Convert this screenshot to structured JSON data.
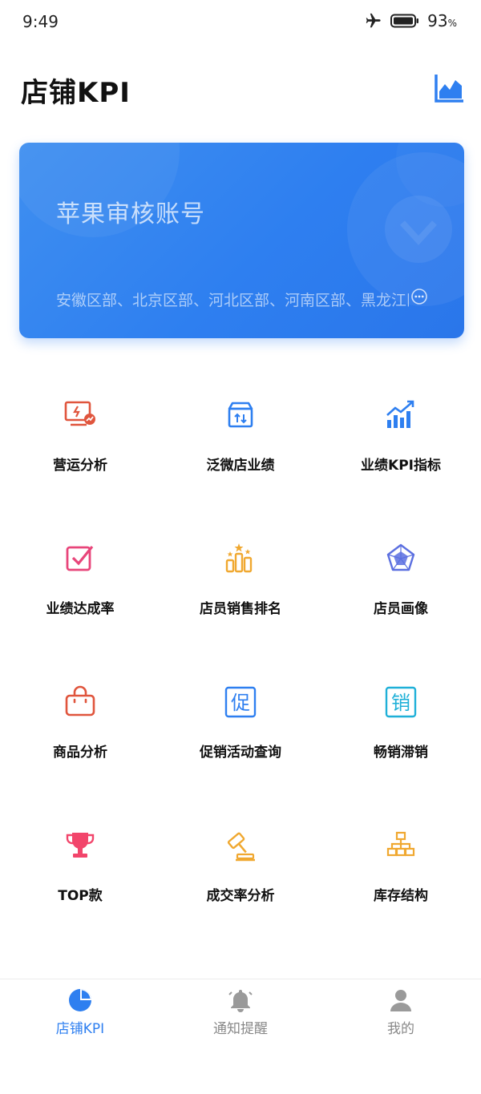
{
  "status_bar": {
    "time": "9:49",
    "battery_pct": "93",
    "battery_unit": "%"
  },
  "header": {
    "title": "店铺KPI"
  },
  "account_card": {
    "name": "苹果审核账号",
    "regions": "安徽区部、北京区部、河北区部、河南区部、黑龙江区部"
  },
  "menu": [
    {
      "label": "营运分析",
      "icon": "operations-analysis-icon",
      "color": "#e0553d"
    },
    {
      "label": "泛微店业绩",
      "icon": "store-box-icon",
      "color": "#2e7ff0"
    },
    {
      "label": "业绩KPI指标",
      "icon": "bar-trend-icon",
      "color": "#2e7ff0"
    },
    {
      "label": "业绩达成率",
      "icon": "checkbox-icon",
      "color": "#e8457a"
    },
    {
      "label": "店员销售排名",
      "icon": "ranking-icon",
      "color": "#f0a830"
    },
    {
      "label": "店员画像",
      "icon": "radar-icon",
      "color": "#5b6fe0"
    },
    {
      "label": "商品分析",
      "icon": "shopping-bag-icon",
      "color": "#e0553d"
    },
    {
      "label": "促销活动查询",
      "icon": "promotion-icon",
      "color": "#2e7ff0",
      "glyph": "促"
    },
    {
      "label": "畅销滞销",
      "icon": "sales-icon",
      "color": "#1fb0d8",
      "glyph": "销"
    },
    {
      "label": "TOP款",
      "icon": "trophy-icon",
      "color": "#f2456b"
    },
    {
      "label": "成交率分析",
      "icon": "gavel-icon",
      "color": "#f0a830"
    },
    {
      "label": "库存结构",
      "icon": "hierarchy-icon",
      "color": "#f0a830"
    }
  ],
  "tabs": [
    {
      "label": "店铺KPI",
      "icon": "pie-chart-icon",
      "active": true
    },
    {
      "label": "通知提醒",
      "icon": "bell-icon",
      "active": false
    },
    {
      "label": "我的",
      "icon": "user-icon",
      "active": false
    }
  ],
  "colors": {
    "accent": "#2e7ff0",
    "tab_inactive": "#888888"
  }
}
